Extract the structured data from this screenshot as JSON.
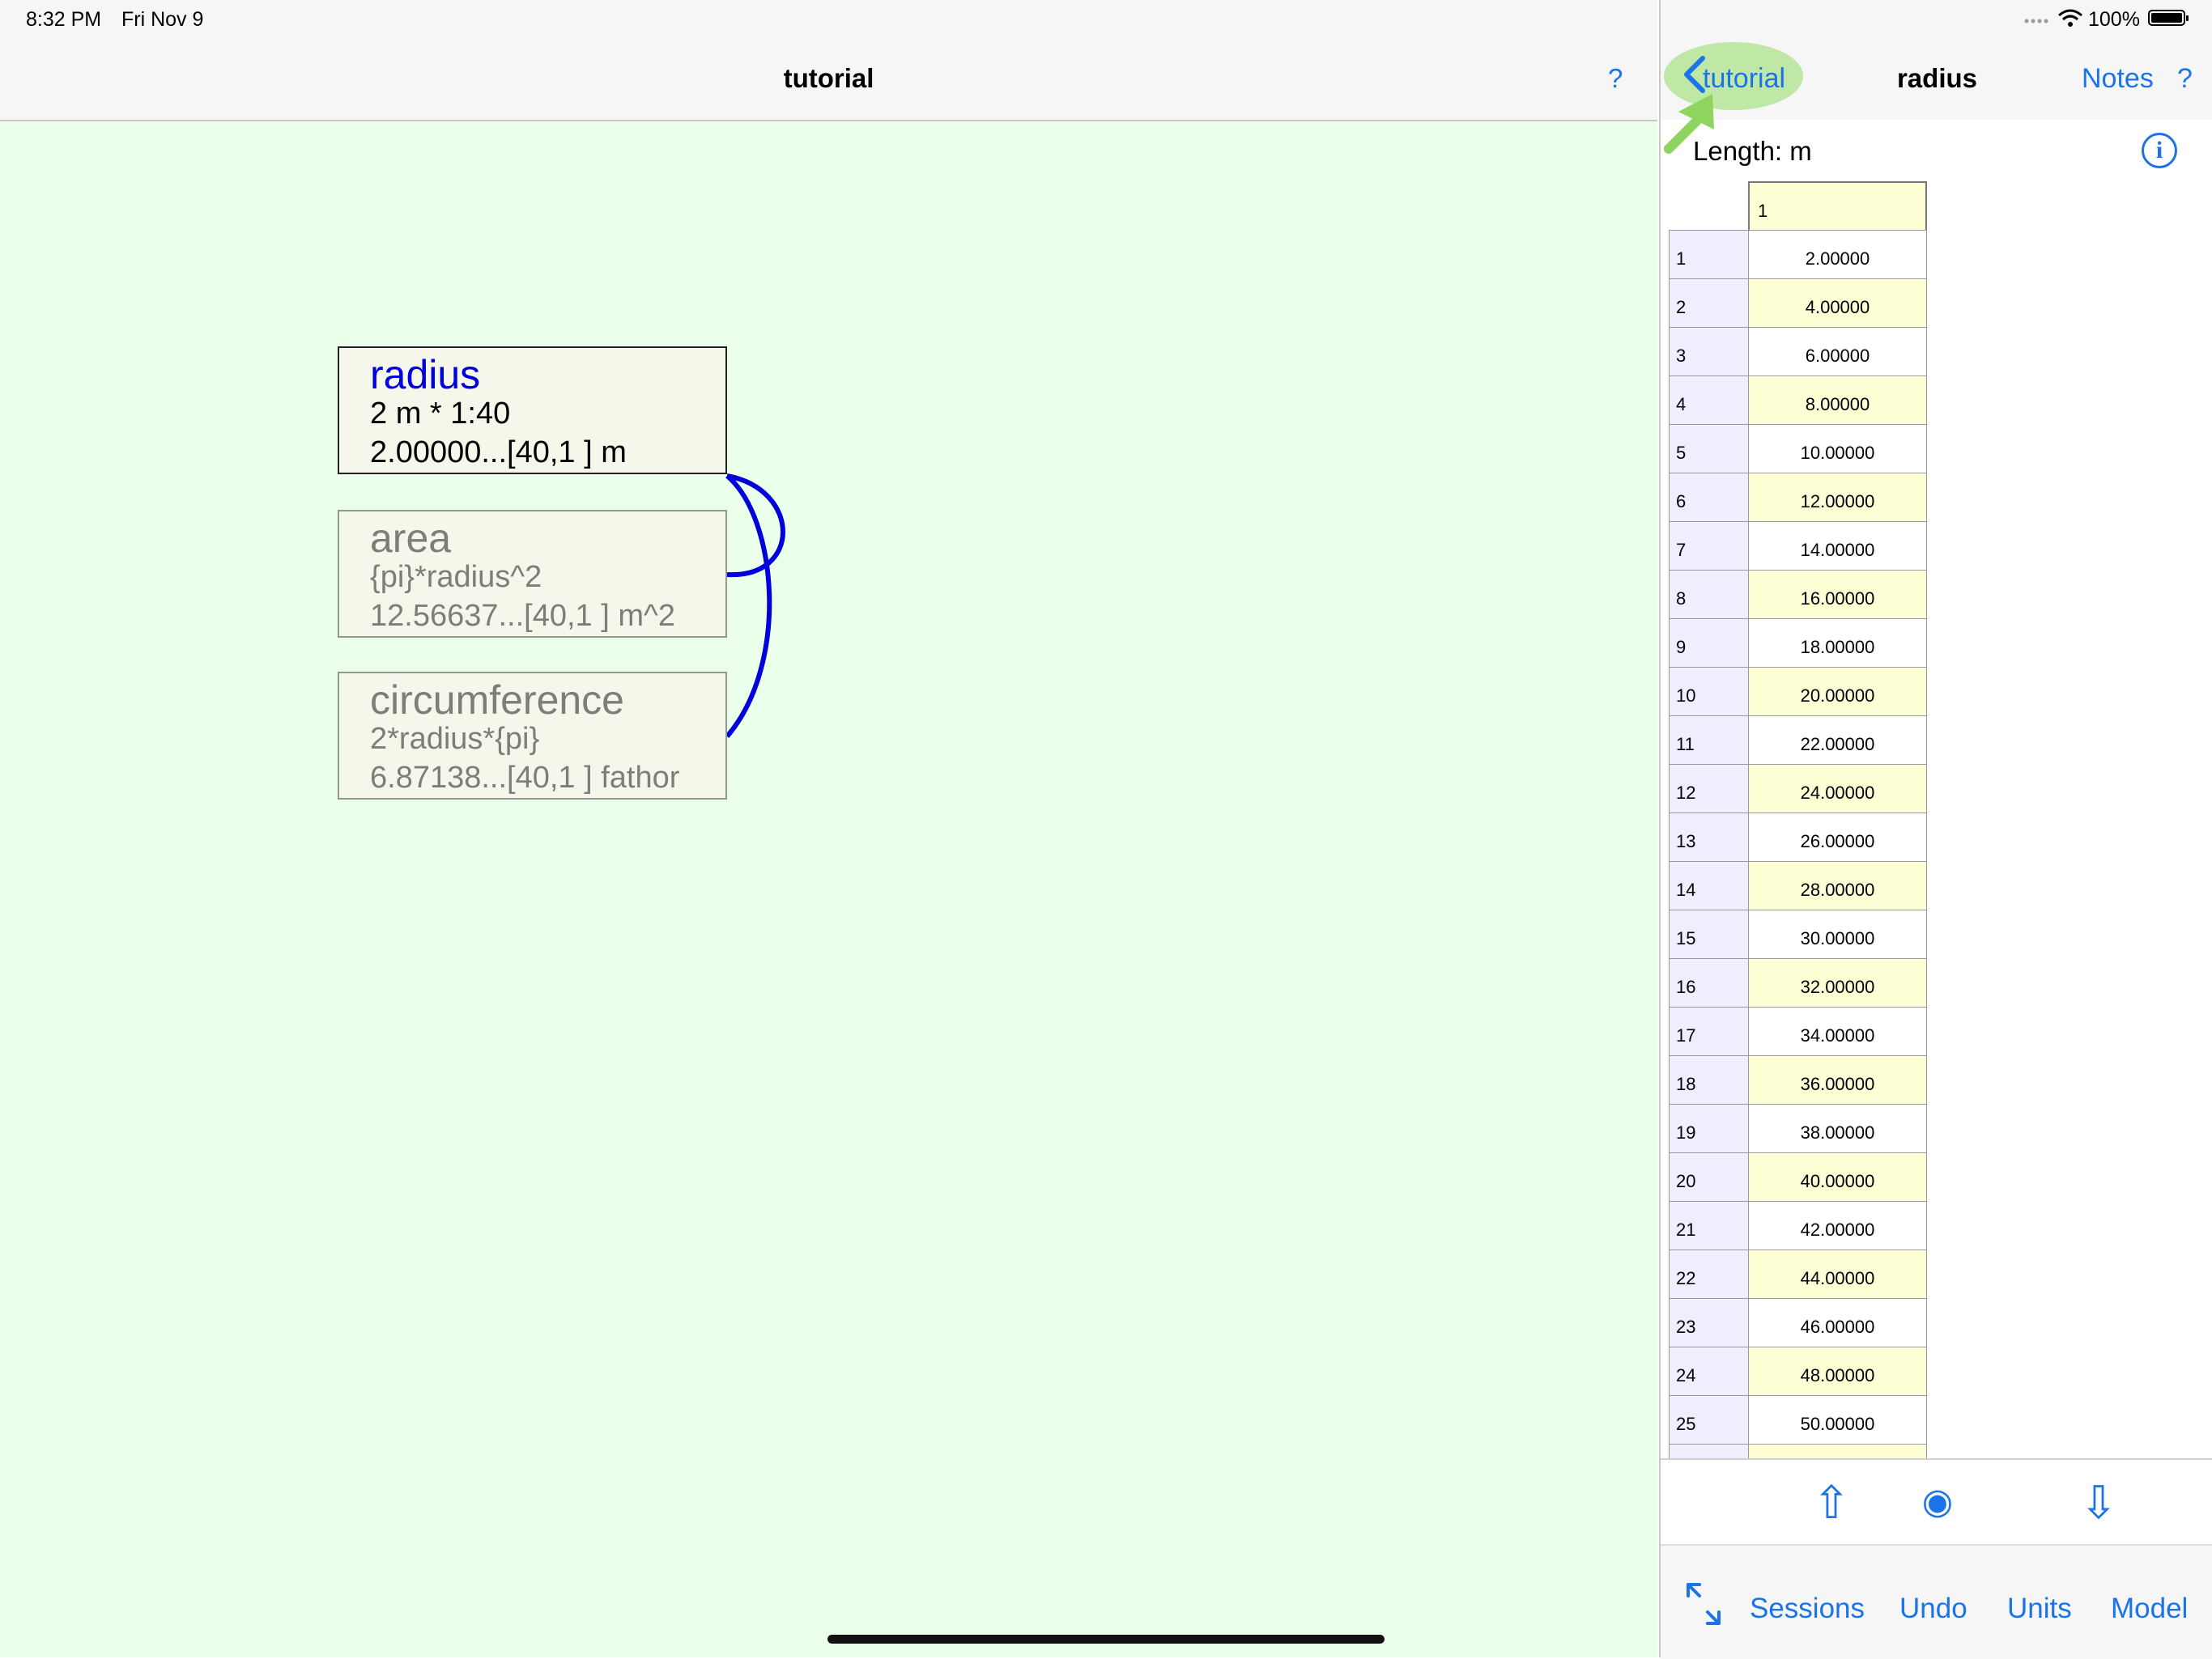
{
  "status_bar": {
    "time": "8:32 PM",
    "date": "Fri Nov 9",
    "battery": "100%"
  },
  "left_nav": {
    "title": "tutorial",
    "help": "?"
  },
  "nodes": [
    {
      "name": "radius",
      "formula": "2 m * 1:40",
      "value": "2.00000...[40,1 ] m"
    },
    {
      "name": "area",
      "formula": "{pi}*radius^2",
      "value": "12.56637...[40,1 ] m^2"
    },
    {
      "name": "circumference",
      "formula": "2*radius*{pi}",
      "value": "6.87138...[40,1 ] fathor"
    }
  ],
  "right_nav": {
    "back_label": "tutorial",
    "title": "radius",
    "notes": "Notes",
    "help": "?"
  },
  "detail": {
    "length_label": "Length: m",
    "info_icon": "i",
    "column_header": "1",
    "rows": [
      {
        "i": "1",
        "v": "2.00000"
      },
      {
        "i": "2",
        "v": "4.00000"
      },
      {
        "i": "3",
        "v": "6.00000"
      },
      {
        "i": "4",
        "v": "8.00000"
      },
      {
        "i": "5",
        "v": "10.00000"
      },
      {
        "i": "6",
        "v": "12.00000"
      },
      {
        "i": "7",
        "v": "14.00000"
      },
      {
        "i": "8",
        "v": "16.00000"
      },
      {
        "i": "9",
        "v": "18.00000"
      },
      {
        "i": "10",
        "v": "20.00000"
      },
      {
        "i": "11",
        "v": "22.00000"
      },
      {
        "i": "12",
        "v": "24.00000"
      },
      {
        "i": "13",
        "v": "26.00000"
      },
      {
        "i": "14",
        "v": "28.00000"
      },
      {
        "i": "15",
        "v": "30.00000"
      },
      {
        "i": "16",
        "v": "32.00000"
      },
      {
        "i": "17",
        "v": "34.00000"
      },
      {
        "i": "18",
        "v": "36.00000"
      },
      {
        "i": "19",
        "v": "38.00000"
      },
      {
        "i": "20",
        "v": "40.00000"
      },
      {
        "i": "21",
        "v": "42.00000"
      },
      {
        "i": "22",
        "v": "44.00000"
      },
      {
        "i": "23",
        "v": "46.00000"
      },
      {
        "i": "24",
        "v": "48.00000"
      },
      {
        "i": "25",
        "v": "50.00000"
      },
      {
        "i": "",
        "v": ""
      }
    ]
  },
  "stepper": {
    "up": "⇧",
    "center": "◉",
    "down": "⇩"
  },
  "toolbar": {
    "sessions": "Sessions",
    "undo": "Undo",
    "units": "Units",
    "model": "Model"
  },
  "colors": {
    "accent": "#1a73e8",
    "link_curve": "#0000dd",
    "canvas_bg": "#ebffeb",
    "cell_yellow": "#ffffd6",
    "index_bg": "#eeeeff",
    "highlight_green": "#bfe7a6"
  }
}
